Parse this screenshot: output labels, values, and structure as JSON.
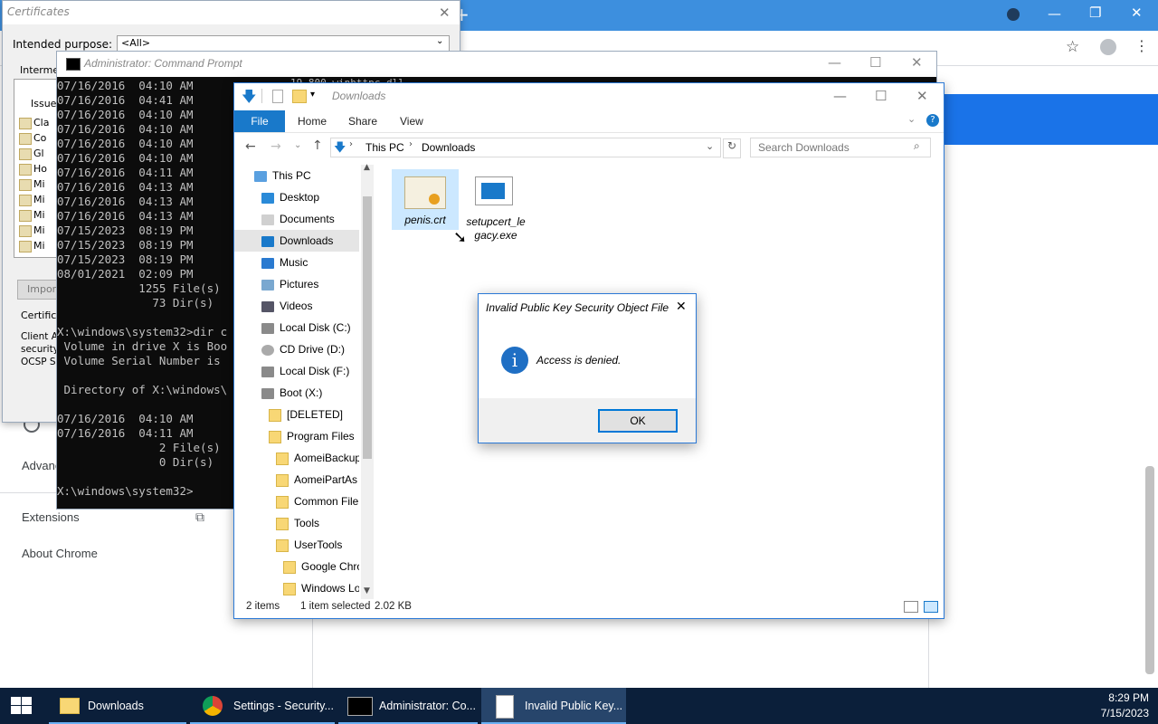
{
  "chrome": {
    "sidebar": {
      "advanced": "Advanc",
      "extensions": "Extensions",
      "about": "About Chrome"
    },
    "window_controls": {
      "minimize": "—",
      "maximize": "❐",
      "close": "✕"
    }
  },
  "certificates": {
    "title": "Certificates",
    "intended_purpose_label": "Intended purpose:",
    "intended_purpose_value": "<All>",
    "tab_label": "Intermec",
    "list_header": "Issued",
    "rows": [
      "Cla",
      "Co",
      "Gl",
      "Ho",
      "Mi",
      "Mi",
      "Mi",
      "Mi",
      "Mi"
    ],
    "import_label": "Import",
    "cert_purposes_label": "Certifica",
    "purposes_text": [
      "Client Au",
      "security",
      "OCSP Si"
    ]
  },
  "cmd": {
    "title": "Administrator: Command Prompt",
    "top_fragment": "19,800 winhttpc.dll",
    "lines": [
      "07/16/2016  04:10 AM",
      "07/16/2016  04:41 AM",
      "07/16/2016  04:10 AM",
      "07/16/2016  04:10 AM",
      "07/16/2016  04:10 AM",
      "07/16/2016  04:10 AM",
      "07/16/2016  04:11 AM",
      "07/16/2016  04:13 AM",
      "07/16/2016  04:13 AM",
      "07/16/2016  04:13 AM",
      "07/15/2023  08:19 PM",
      "07/15/2023  08:19 PM",
      "07/15/2023  08:19 PM",
      "08/01/2021  02:09 PM",
      "            1255 File(s)",
      "              73 Dir(s)",
      "",
      "X:\\windows\\system32>dir c",
      " Volume in drive X is Boo",
      " Volume Serial Number is",
      "",
      " Directory of X:\\windows\\",
      "",
      "07/16/2016  04:10 AM",
      "07/16/2016  04:11 AM",
      "               2 File(s)",
      "               0 Dir(s)",
      "",
      "X:\\windows\\system32>"
    ]
  },
  "explorer": {
    "title": "Downloads",
    "ribbon": {
      "file": "File",
      "home": "Home",
      "share": "Share",
      "view": "View"
    },
    "address": {
      "root": "This PC",
      "sep": "›",
      "current": "Downloads"
    },
    "search_placeholder": "Search Downloads",
    "nav": [
      {
        "label": "This PC",
        "icon": "pc-icon",
        "indent": 0
      },
      {
        "label": "Desktop",
        "icon": "desktop-icon",
        "indent": 1
      },
      {
        "label": "Documents",
        "icon": "documents-icon",
        "indent": 1
      },
      {
        "label": "Downloads",
        "icon": "download-icon",
        "indent": 1,
        "selected": true
      },
      {
        "label": "Music",
        "icon": "music-icon",
        "indent": 1
      },
      {
        "label": "Pictures",
        "icon": "pictures-icon",
        "indent": 1
      },
      {
        "label": "Videos",
        "icon": "videos-icon",
        "indent": 1
      },
      {
        "label": "Local Disk (C:)",
        "icon": "drive-icon",
        "indent": 1
      },
      {
        "label": "CD Drive (D:)",
        "icon": "cd-icon",
        "indent": 1
      },
      {
        "label": "Local Disk (F:)",
        "icon": "drive-icon",
        "indent": 1
      },
      {
        "label": "Boot (X:)",
        "icon": "drive-icon",
        "indent": 1
      },
      {
        "label": "[DELETED]",
        "icon": "folder-icon",
        "indent": 2
      },
      {
        "label": "Program Files",
        "icon": "folder-icon",
        "indent": 2
      },
      {
        "label": "AomeiBackup",
        "icon": "folder-icon",
        "indent": 3
      },
      {
        "label": "AomeiPartAs",
        "icon": "folder-icon",
        "indent": 3
      },
      {
        "label": "Common File",
        "icon": "folder-icon",
        "indent": 3
      },
      {
        "label": "Tools",
        "icon": "folder-icon",
        "indent": 3
      },
      {
        "label": "UserTools",
        "icon": "folder-icon",
        "indent": 3
      },
      {
        "label": "Google Chro",
        "icon": "folder-icon",
        "indent": 4
      },
      {
        "label": "Windows Lo",
        "icon": "folder-icon",
        "indent": 4
      }
    ],
    "files": [
      {
        "name": "penis.crt",
        "icon": "certificate-icon",
        "selected": true
      },
      {
        "name": "setupcert_le gacy.exe",
        "icon": "exe-icon",
        "selected": false
      }
    ],
    "status": {
      "count": "2 items",
      "selected": "1 item selected",
      "size": "2.02 KB"
    }
  },
  "dialog": {
    "title": "Invalid Public Key Security Object File",
    "message": "Access is denied.",
    "ok": "OK",
    "close": "✕"
  },
  "taskbar": {
    "items": [
      {
        "label": "Downloads",
        "icon": "folder-icon"
      },
      {
        "label": "Settings - Security...",
        "icon": "chrome-icon"
      },
      {
        "label": "Administrator: Co...",
        "icon": "cmd-icon"
      },
      {
        "label": "Invalid Public Key...",
        "icon": "document-icon"
      }
    ],
    "time": "8:29 PM",
    "date": "7/15/2023"
  },
  "colors": {
    "accent": "#0078d7",
    "chrome_blue": "#1a73e8",
    "taskbar": "#0b1f3a"
  }
}
